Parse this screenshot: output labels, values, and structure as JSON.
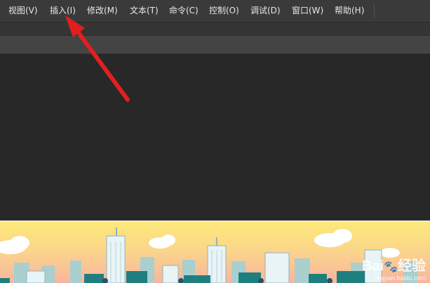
{
  "menubar": {
    "items": [
      {
        "label": "视图(V)"
      },
      {
        "label": "插入(I)"
      },
      {
        "label": "修改(M)"
      },
      {
        "label": "文本(T)"
      },
      {
        "label": "命令(C)"
      },
      {
        "label": "控制(O)"
      },
      {
        "label": "调试(D)"
      },
      {
        "label": "窗口(W)"
      },
      {
        "label": "帮助(H)"
      }
    ]
  },
  "annotation": {
    "arrow_color": "#e02020"
  },
  "banner": {
    "sky_top": "#fde97a",
    "sky_bottom": "#f7b5a0",
    "watermark_brand": "Bai",
    "watermark_brand_suffix": "经验",
    "watermark_url": "jingyan.baidu.com"
  }
}
